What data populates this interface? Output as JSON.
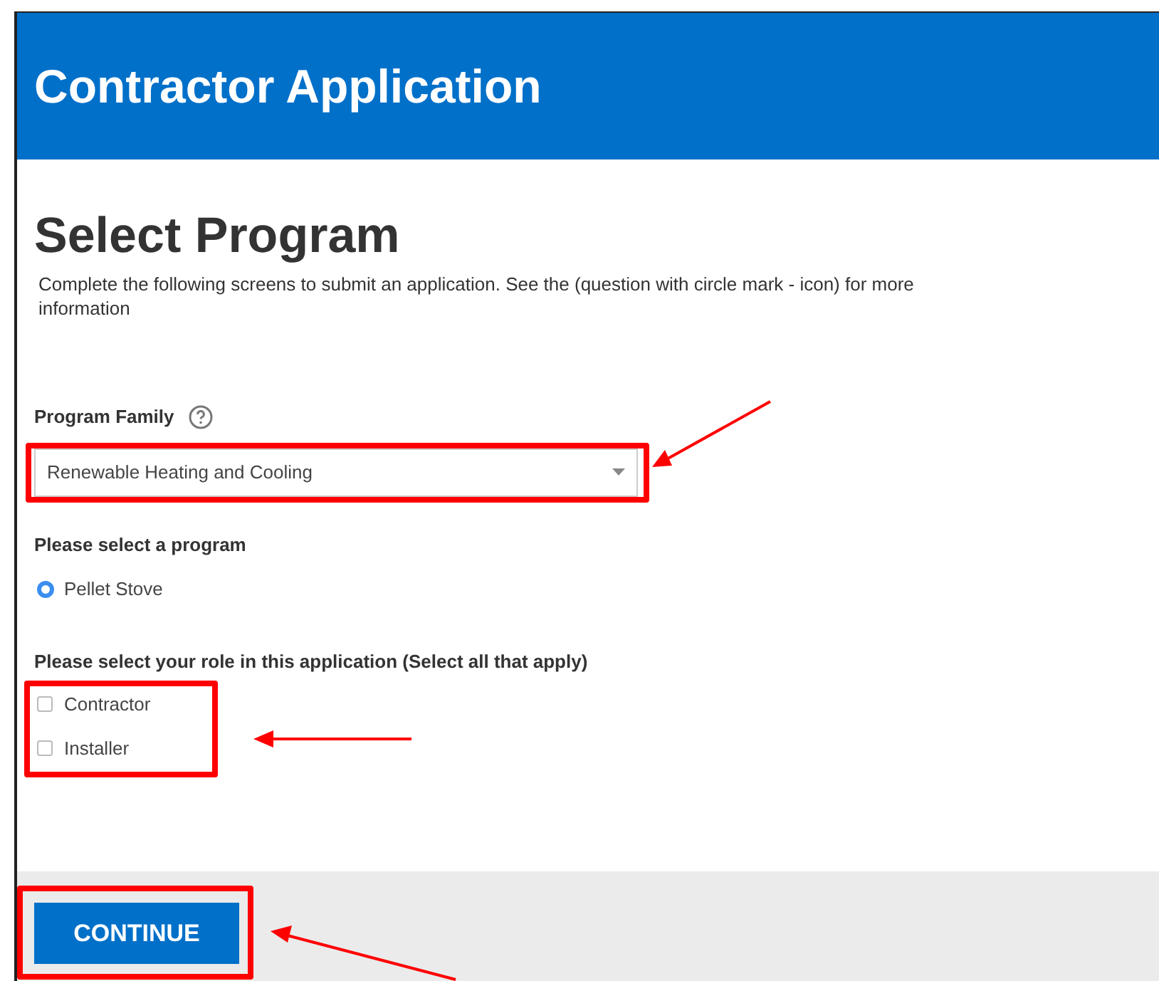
{
  "header": {
    "title": "Contractor Application"
  },
  "page": {
    "heading": "Select Program",
    "description": "Complete the following screens to submit an application. See the (question with circle mark - icon) for more information"
  },
  "program_family": {
    "label": "Program Family",
    "value": "Renewable Heating and Cooling"
  },
  "program": {
    "label": "Please select a program",
    "options": [
      {
        "label": "Pellet Stove",
        "selected": true
      }
    ]
  },
  "role": {
    "label": "Please select your role in this application (Select all that apply)",
    "options": [
      {
        "label": "Contractor",
        "checked": false
      },
      {
        "label": "Installer",
        "checked": false
      }
    ]
  },
  "footer": {
    "button": "CONTINUE"
  }
}
